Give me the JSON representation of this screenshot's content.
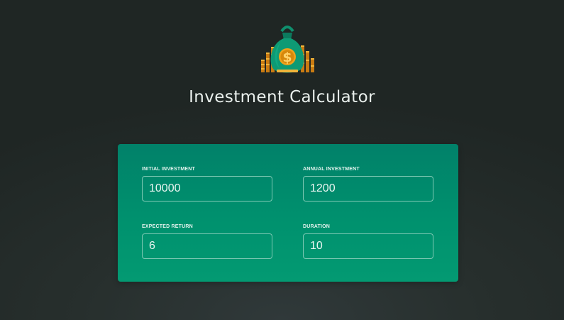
{
  "header": {
    "logo_icon": "money-bag-icon",
    "title": "Investment Calculator"
  },
  "colors": {
    "background": "#272f2d",
    "card_top": "#018169",
    "card_bottom": "#039a72",
    "input_border": "#7ec9b4",
    "logo_gold": "#f0a21a"
  },
  "form": {
    "initial_investment": {
      "label": "Initial Investment",
      "value": "10000"
    },
    "annual_investment": {
      "label": "Annual Investment",
      "value": "1200"
    },
    "expected_return": {
      "label": "Expected Return",
      "value": "6"
    },
    "duration": {
      "label": "Duration",
      "value": "10"
    }
  }
}
